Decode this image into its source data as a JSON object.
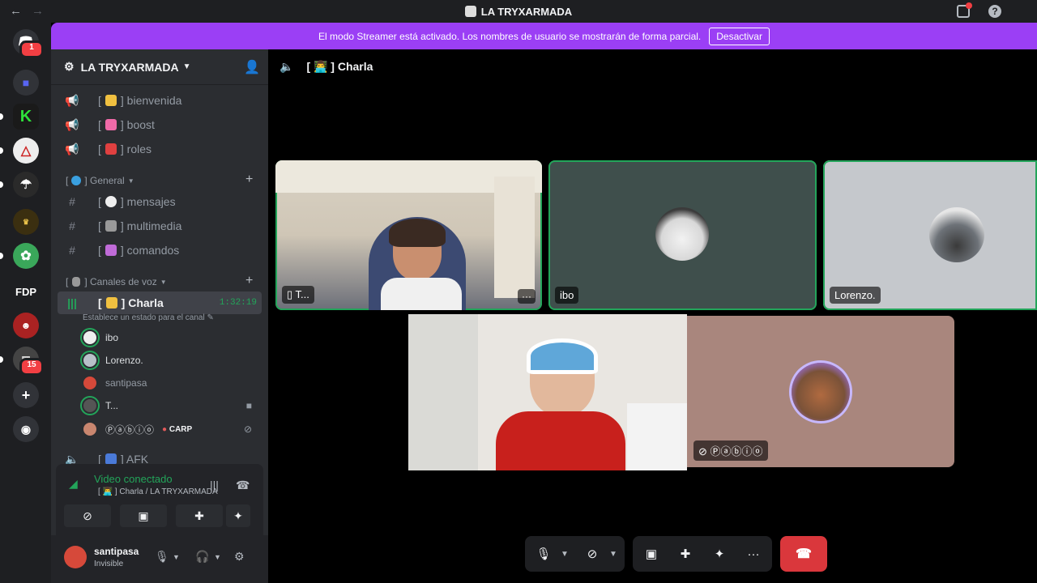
{
  "window": {
    "title": "LA TRYXARMADA",
    "back_icon": "←",
    "forward_icon": "→"
  },
  "banner": {
    "text": "El modo Streamer está activado. Los nombres de usuario se mostrarán de forma parcial.",
    "button": "Desactivar",
    "color": "#9b3ff5"
  },
  "rail": {
    "dm_badge": "1",
    "fdp_label": "FDP",
    "server_badge": "15"
  },
  "guild": {
    "name": "LA TRYXARMADA"
  },
  "channels": {
    "bienvenida": {
      "prefix": "[",
      "name": "] bienvenida"
    },
    "boost": {
      "prefix": "[",
      "name": "] boost"
    },
    "roles": {
      "prefix": "[",
      "name": "] roles"
    },
    "cat_general": {
      "prefix": "[",
      "name": "] General"
    },
    "mensajes": {
      "prefix": "[",
      "name": "] mensajes"
    },
    "multimedia": {
      "prefix": "[",
      "name": "] multimedia"
    },
    "comandos": {
      "prefix": "[",
      "name": "] comandos"
    },
    "cat_voice": {
      "prefix": "[",
      "name": "] Canales de voz"
    },
    "charla": {
      "prefix": "[",
      "name": "] Charla",
      "timer": "1:32:19",
      "status": "Establece un estado para el canal"
    },
    "afk": {
      "prefix": "[",
      "name": "] AFK"
    }
  },
  "voice_users": [
    {
      "name": "ibo"
    },
    {
      "name": "Lorenzo."
    },
    {
      "name": "santipasa"
    },
    {
      "name": "T..."
    },
    {
      "name": "Ⓟⓐⓑⓘⓞ",
      "tag": "CARP"
    }
  ],
  "voice_panel": {
    "status": "Video conectado",
    "channel": "[ 👨‍💻 ] Charla / LA TRYXARMADA"
  },
  "user": {
    "name": "santipasa",
    "status": "Invisible"
  },
  "main": {
    "channel": "[ 👨‍💻 ] Charla",
    "tiles": {
      "t": "T...",
      "ibo": "ibo",
      "lorenzo": "Lorenzo.",
      "pablo": "Ⓟⓐⓑⓘⓞ"
    }
  }
}
